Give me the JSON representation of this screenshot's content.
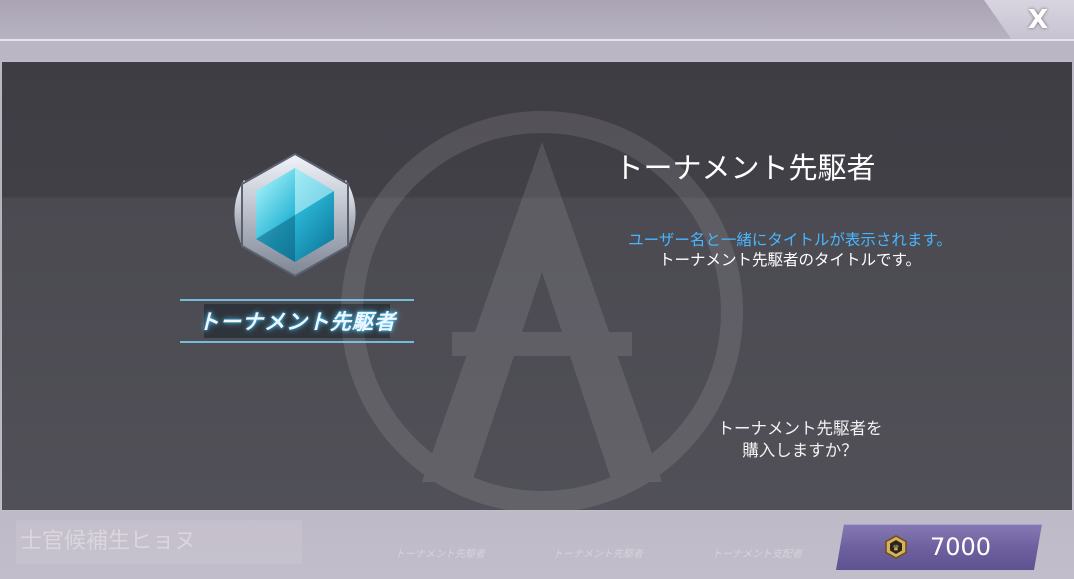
{
  "header": {
    "close_label": "X"
  },
  "background": {
    "ghost_name": "士官候補生ヒョヌ",
    "ghost_tags": [
      "トーナメント先駆者",
      "トーナメント先駆者",
      "トーナメント支配者"
    ]
  },
  "item": {
    "title_art_text": "トーナメント先駆者",
    "name": "トーナメント先駆者",
    "description_blue": "ユーザー名と一緒にタイトルが表示されます。",
    "description_white": "トーナメント先駆者のタイトルです。",
    "confirm_line1": "トーナメント先駆者を",
    "confirm_line2": "購入しますか？"
  },
  "purchase": {
    "price": "7000",
    "currency_icon": "gold-coin-icon"
  },
  "colors": {
    "accent_blue": "#48b6ff",
    "button": "#6f61a0"
  }
}
